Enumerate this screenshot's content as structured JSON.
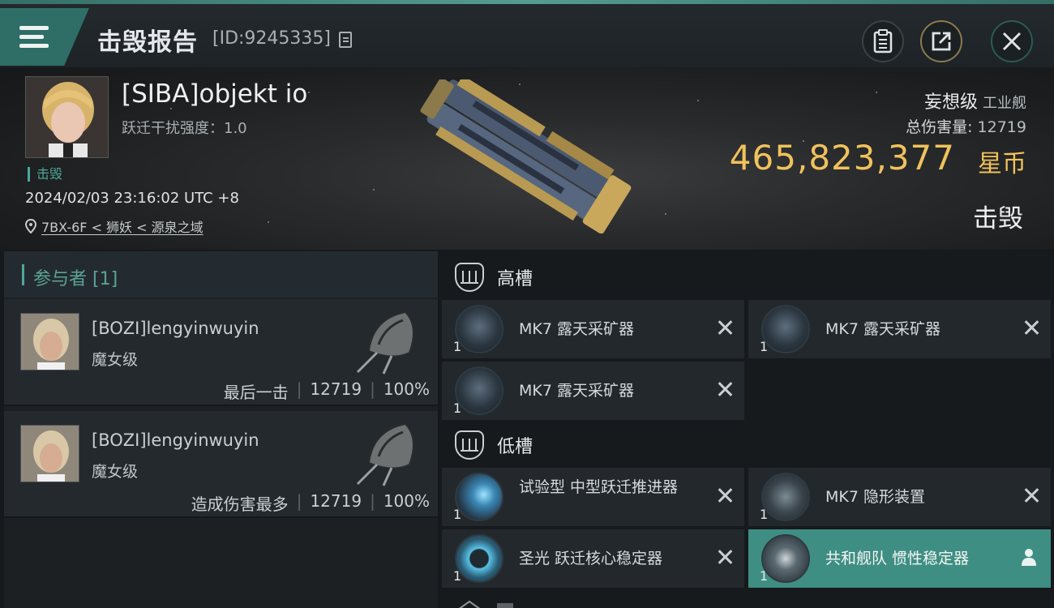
{
  "header": {
    "title": "击毁报告",
    "report_id": "[ID:9245335]",
    "menu_icon": "hamburger-menu-icon",
    "buttons": [
      "clipboard-icon",
      "share-icon",
      "close-icon"
    ]
  },
  "victim": {
    "pilot_name": "[SIBA]objekt io",
    "warp_disruption": "跃迁干扰强度：1.0",
    "status_tag": "击毁",
    "datetime": "2024/02/03 23:16:02 UTC +8",
    "location": "7BX-6F < 狮妖 < 源泉之域",
    "ship_class": "妄想级",
    "ship_type": "工业舰",
    "total_damage_label": "总伤害量: ",
    "total_damage_value": "12719",
    "isk_value": "465,823,377",
    "isk_unit": "星币",
    "result": "击毁"
  },
  "participants": {
    "header": "参与者 [1]",
    "rows": [
      {
        "name": "[BOZI]lengyinwuyin",
        "ship": "魔女级",
        "role": "最后一击",
        "damage": "12719",
        "percent": "100%"
      },
      {
        "name": "[BOZI]lengyinwuyin",
        "ship": "魔女级",
        "role": "造成伤害最多",
        "damage": "12719",
        "percent": "100%"
      }
    ]
  },
  "fitting": {
    "high_slot_title": "高槽",
    "low_slot_title": "低槽",
    "high_slots": [
      {
        "name": "MK7 露天采矿器",
        "qty": "1",
        "status": "destroyed"
      },
      {
        "name": "MK7 露天采矿器",
        "qty": "1",
        "status": "destroyed"
      },
      {
        "name": "MK7 露天采矿器",
        "qty": "1",
        "status": "destroyed"
      }
    ],
    "low_slots": [
      {
        "name": "试验型 中型跃迁推进器",
        "qty": "1",
        "status": "destroyed"
      },
      {
        "name": "MK7 隐形装置",
        "qty": "1",
        "status": "destroyed"
      },
      {
        "name": "圣光 跃迁核心稳定器",
        "qty": "1",
        "status": "destroyed"
      },
      {
        "name": "共和舰队 惯性稳定器",
        "qty": "1",
        "status": "dropped"
      }
    ]
  },
  "colors": {
    "accent_teal": "#3f8e83",
    "isk_gold": "#f0c25c",
    "panel_dark": "#22282c"
  }
}
